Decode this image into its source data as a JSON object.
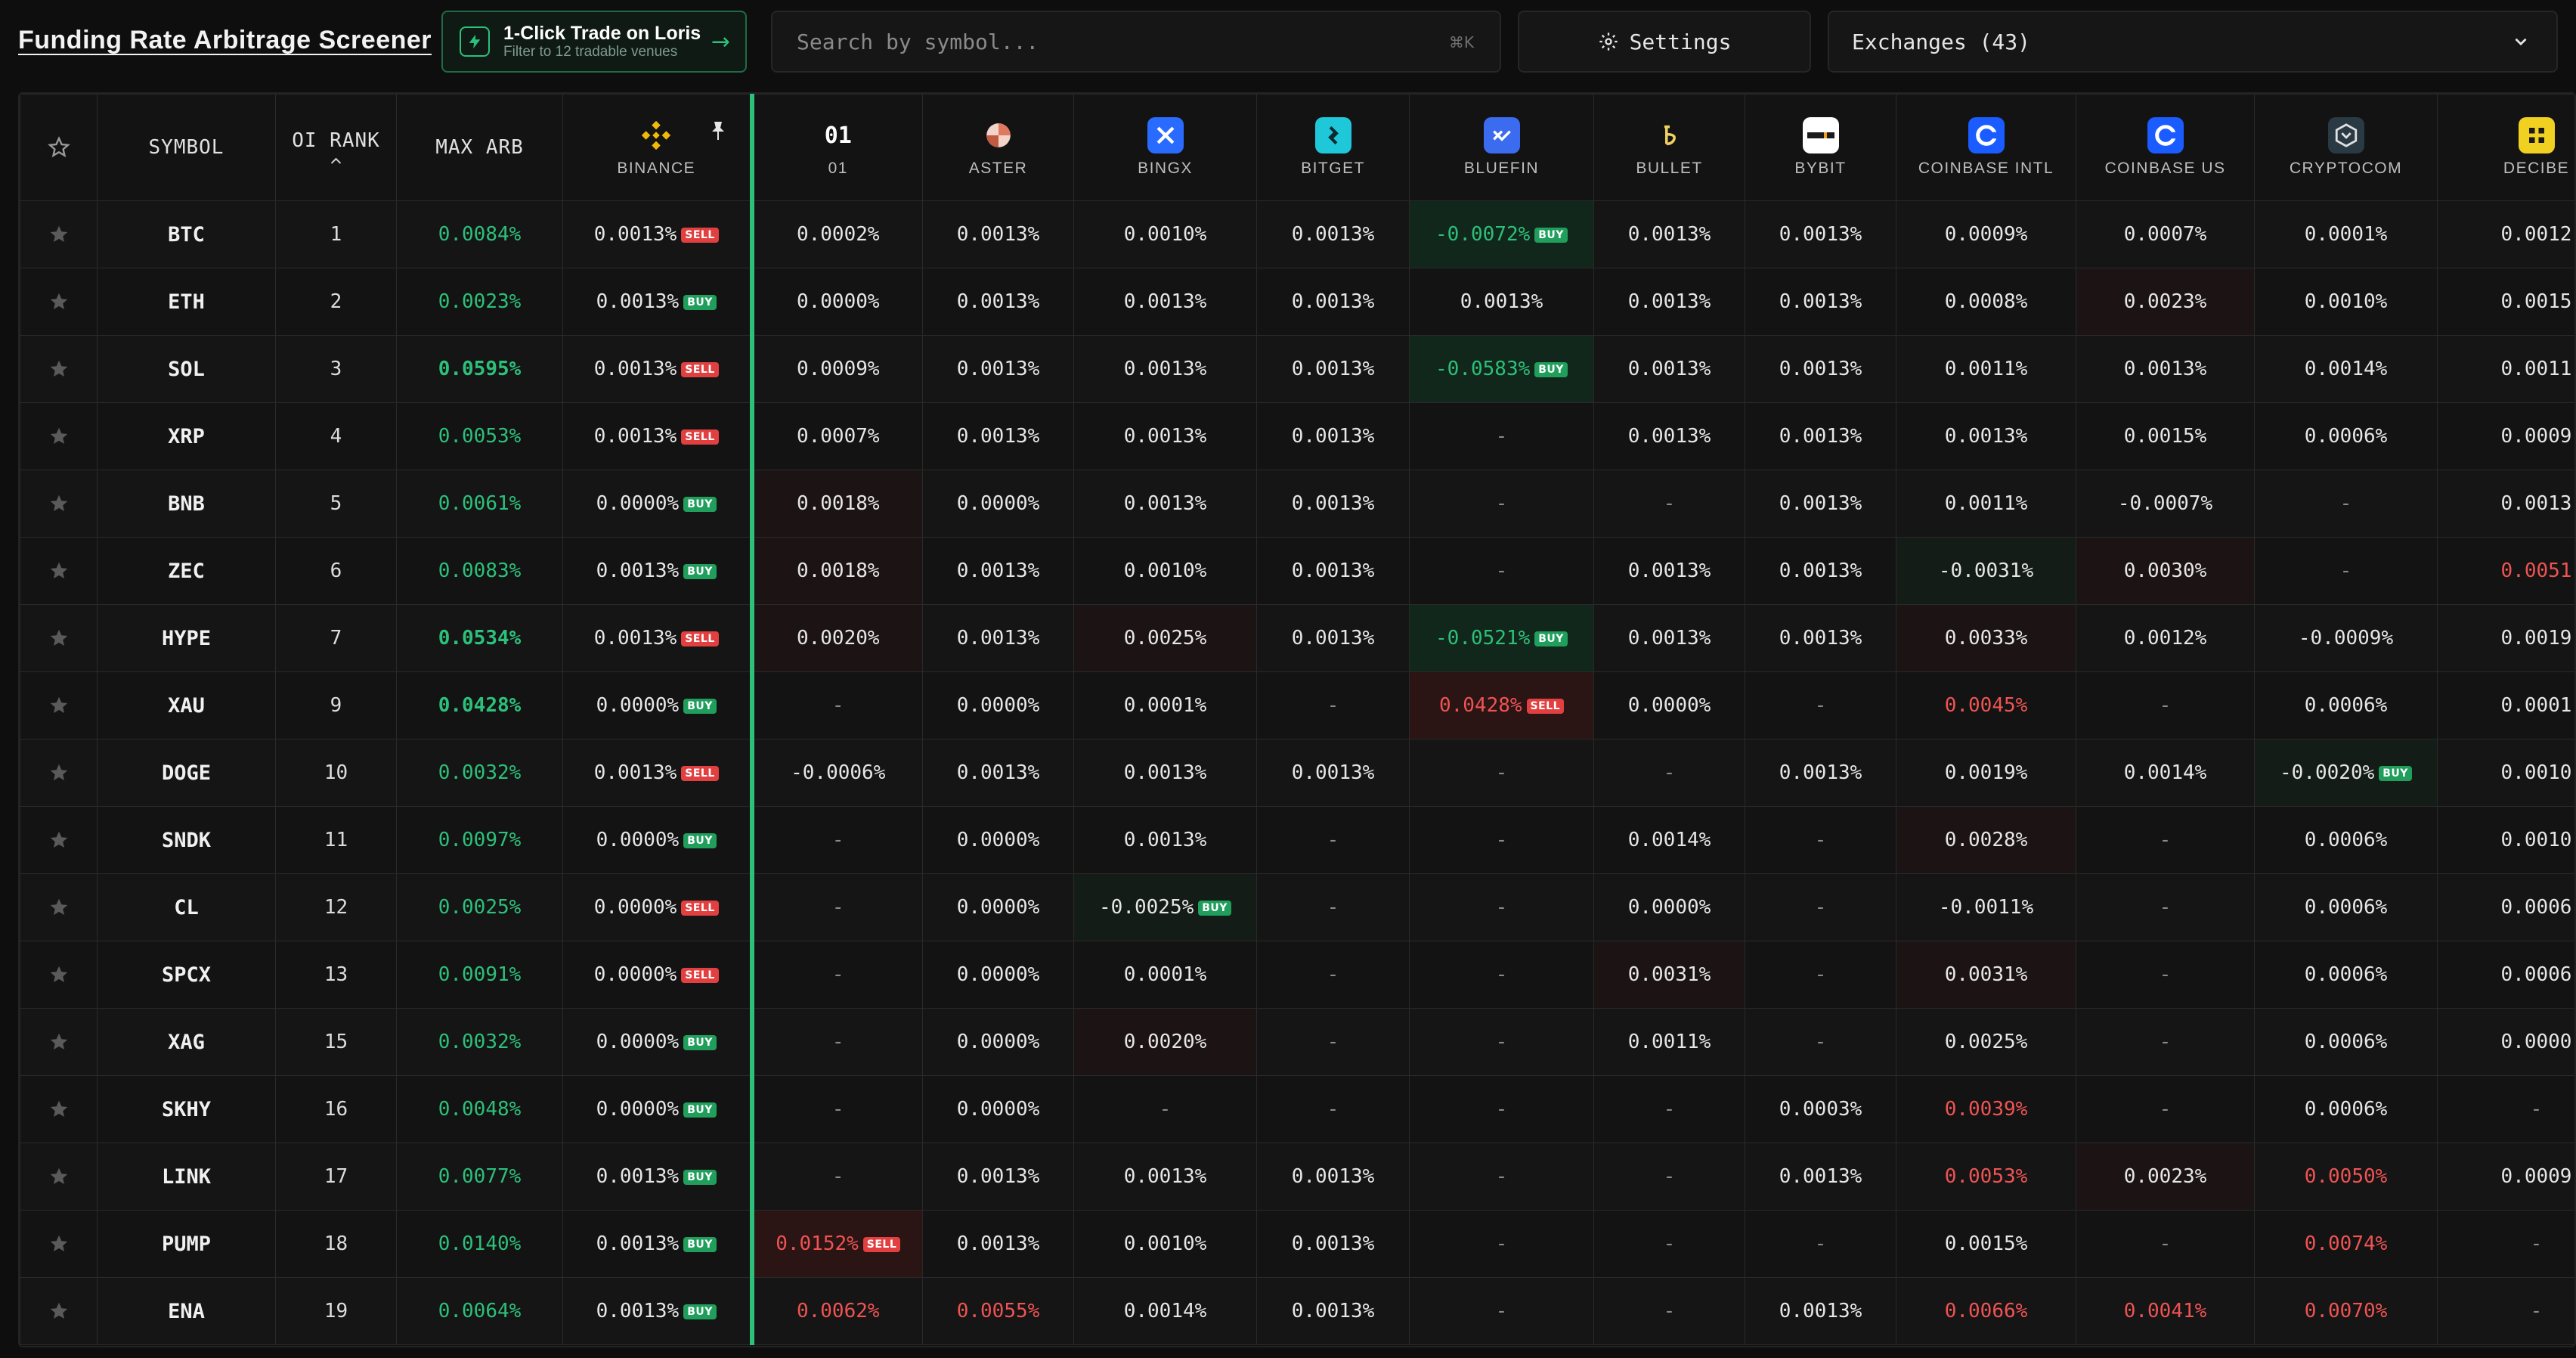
{
  "header": {
    "title": "Funding Rate Arbitrage Screener",
    "trade_button": {
      "label": "1-Click Trade on Loris",
      "sublabel": "Filter to 12 tradable venues",
      "arrow": "→"
    },
    "search": {
      "placeholder": "Search by symbol...",
      "shortcut": "⌘K"
    },
    "settings_label": "Settings",
    "exchanges_label": "Exchanges (43)"
  },
  "colors": {
    "accent_green": "#2cc07a",
    "sell_red": "#e24040",
    "buy_green": "#1f9e5c",
    "negative_red_text": "#ef5353"
  },
  "columns": {
    "symbol": "SYMBOL",
    "oi_rank": "OI RANK",
    "max_arb": "MAX ARB",
    "exchanges": [
      {
        "name": "BINANCE",
        "icon": "binance-icon",
        "color": "#f0b90b"
      },
      {
        "name": "01",
        "icon": "01-text-icon",
        "color": "#ffffff"
      },
      {
        "name": "ASTER",
        "icon": "aster-icon",
        "color": "#e8a090"
      },
      {
        "name": "BINGX",
        "icon": "bingx-icon",
        "color": "#2a6bff"
      },
      {
        "name": "BITGET",
        "icon": "bitget-icon",
        "color": "#1ec8d8"
      },
      {
        "name": "BLUEFIN",
        "icon": "bluefin-icon",
        "color": "#3b6cf0"
      },
      {
        "name": "BULLET",
        "icon": "bullet-icon",
        "color": "#f0d060"
      },
      {
        "name": "BYBIT",
        "icon": "bybit-icon",
        "color": "#ffffff"
      },
      {
        "name": "COINBASE INTL",
        "icon": "coinbase-icon",
        "color": "#1a5cff"
      },
      {
        "name": "COINBASE US",
        "icon": "coinbase-icon",
        "color": "#1a5cff"
      },
      {
        "name": "CRYPTOCOM",
        "icon": "cryptocom-icon",
        "color": "#2a3a44"
      },
      {
        "name": "DECIBE",
        "icon": "decibel-icon",
        "color": "#f0d020"
      }
    ]
  },
  "rows": [
    {
      "symbol": "BTC",
      "rank": "1",
      "arb": "0.0084%",
      "bold": false,
      "binance": {
        "v": "0.0013%",
        "b": "SELL"
      },
      "cells": [
        [
          "0.0002%"
        ],
        [
          "0.0013%"
        ],
        [
          "0.0010%"
        ],
        [
          "0.0013%"
        ],
        [
          "-0.0072%",
          "neg-green",
          "BUY"
        ],
        [
          "0.0013%"
        ],
        [
          "0.0013%"
        ],
        [
          "0.0009%"
        ],
        [
          "0.0007%"
        ],
        [
          "0.0001%"
        ],
        [
          "0.0012"
        ]
      ]
    },
    {
      "symbol": "ETH",
      "rank": "2",
      "arb": "0.0023%",
      "bold": false,
      "binance": {
        "v": "0.0013%",
        "b": "BUY"
      },
      "cells": [
        [
          "0.0000%"
        ],
        [
          "0.0013%"
        ],
        [
          "0.0013%"
        ],
        [
          "0.0013%"
        ],
        [
          "0.0013%"
        ],
        [
          "0.0013%"
        ],
        [
          "0.0013%"
        ],
        [
          "0.0008%"
        ],
        [
          "0.0023%",
          "tint-red"
        ],
        [
          "0.0010%"
        ],
        [
          "0.0015"
        ]
      ]
    },
    {
      "symbol": "SOL",
      "rank": "3",
      "arb": "0.0595%",
      "bold": true,
      "binance": {
        "v": "0.0013%",
        "b": "SELL"
      },
      "cells": [
        [
          "0.0009%"
        ],
        [
          "0.0013%"
        ],
        [
          "0.0013%"
        ],
        [
          "0.0013%"
        ],
        [
          "-0.0583%",
          "neg-green",
          "BUY"
        ],
        [
          "0.0013%"
        ],
        [
          "0.0013%"
        ],
        [
          "0.0011%"
        ],
        [
          "0.0013%"
        ],
        [
          "0.0014%"
        ],
        [
          "0.0011"
        ]
      ]
    },
    {
      "symbol": "XRP",
      "rank": "4",
      "arb": "0.0053%",
      "bold": false,
      "binance": {
        "v": "0.0013%",
        "b": "SELL"
      },
      "cells": [
        [
          "0.0007%"
        ],
        [
          "0.0013%"
        ],
        [
          "0.0013%"
        ],
        [
          "0.0013%"
        ],
        [
          "-",
          "dash"
        ],
        [
          "0.0013%"
        ],
        [
          "0.0013%"
        ],
        [
          "0.0013%"
        ],
        [
          "0.0015%"
        ],
        [
          "0.0006%"
        ],
        [
          "0.0009"
        ]
      ]
    },
    {
      "symbol": "BNB",
      "rank": "5",
      "arb": "0.0061%",
      "bold": false,
      "binance": {
        "v": "0.0000%",
        "b": "BUY"
      },
      "cells": [
        [
          "0.0018%",
          "tint-red"
        ],
        [
          "0.0000%"
        ],
        [
          "0.0013%"
        ],
        [
          "0.0013%"
        ],
        [
          "-",
          "dash"
        ],
        [
          "-",
          "dash"
        ],
        [
          "0.0013%"
        ],
        [
          "0.0011%"
        ],
        [
          "-0.0007%"
        ],
        [
          "-",
          "dash"
        ],
        [
          "0.0013"
        ]
      ]
    },
    {
      "symbol": "ZEC",
      "rank": "6",
      "arb": "0.0083%",
      "bold": false,
      "binance": {
        "v": "0.0013%",
        "b": "BUY"
      },
      "cells": [
        [
          "0.0018%",
          "tint-red"
        ],
        [
          "0.0013%"
        ],
        [
          "0.0010%"
        ],
        [
          "0.0013%"
        ],
        [
          "-",
          "dash"
        ],
        [
          "0.0013%"
        ],
        [
          "0.0013%"
        ],
        [
          "-0.0031%",
          "tint-green"
        ],
        [
          "0.0030%",
          "tint-red"
        ],
        [
          "-",
          "dash"
        ],
        [
          "0.0051",
          "red-txt"
        ]
      ]
    },
    {
      "symbol": "HYPE",
      "rank": "7",
      "arb": "0.0534%",
      "bold": true,
      "binance": {
        "v": "0.0013%",
        "b": "SELL"
      },
      "cells": [
        [
          "0.0020%",
          "tint-red"
        ],
        [
          "0.0013%"
        ],
        [
          "0.0025%",
          "tint-red"
        ],
        [
          "0.0013%"
        ],
        [
          "-0.0521%",
          "neg-green",
          "BUY"
        ],
        [
          "0.0013%"
        ],
        [
          "0.0013%"
        ],
        [
          "0.0033%",
          "tint-red"
        ],
        [
          "0.0012%"
        ],
        [
          "-0.0009%"
        ],
        [
          "0.0019"
        ]
      ]
    },
    {
      "symbol": "XAU",
      "rank": "9",
      "arb": "0.0428%",
      "bold": true,
      "binance": {
        "v": "0.0000%",
        "b": "BUY"
      },
      "cells": [
        [
          "-",
          "dash"
        ],
        [
          "0.0000%"
        ],
        [
          "0.0001%"
        ],
        [
          "-",
          "dash"
        ],
        [
          "0.0428%",
          "pos-red",
          "SELL"
        ],
        [
          "0.0000%"
        ],
        [
          "-",
          "dash"
        ],
        [
          "0.0045%",
          "red-txt"
        ],
        [
          "-",
          "dash"
        ],
        [
          "0.0006%"
        ],
        [
          "0.0001"
        ]
      ]
    },
    {
      "symbol": "DOGE",
      "rank": "10",
      "arb": "0.0032%",
      "bold": false,
      "binance": {
        "v": "0.0013%",
        "b": "SELL"
      },
      "cells": [
        [
          "-0.0006%"
        ],
        [
          "0.0013%"
        ],
        [
          "0.0013%"
        ],
        [
          "0.0013%"
        ],
        [
          "-",
          "dash"
        ],
        [
          "-",
          "dash"
        ],
        [
          "0.0013%"
        ],
        [
          "0.0019%"
        ],
        [
          "0.0014%"
        ],
        [
          "-0.0020%",
          "tint-green",
          "BUY"
        ],
        [
          "0.0010"
        ]
      ]
    },
    {
      "symbol": "SNDK",
      "rank": "11",
      "arb": "0.0097%",
      "bold": false,
      "binance": {
        "v": "0.0000%",
        "b": "BUY"
      },
      "cells": [
        [
          "-",
          "dash"
        ],
        [
          "0.0000%"
        ],
        [
          "0.0013%"
        ],
        [
          "-",
          "dash"
        ],
        [
          "-",
          "dash"
        ],
        [
          "0.0014%"
        ],
        [
          "-",
          "dash"
        ],
        [
          "0.0028%",
          "tint-red"
        ],
        [
          "-",
          "dash"
        ],
        [
          "0.0006%"
        ],
        [
          "0.0010"
        ]
      ]
    },
    {
      "symbol": "CL",
      "rank": "12",
      "arb": "0.0025%",
      "bold": false,
      "binance": {
        "v": "0.0000%",
        "b": "SELL"
      },
      "cells": [
        [
          "-",
          "dash"
        ],
        [
          "0.0000%"
        ],
        [
          "-0.0025%",
          "tint-green",
          "BUY"
        ],
        [
          "-",
          "dash"
        ],
        [
          "-",
          "dash"
        ],
        [
          "0.0000%"
        ],
        [
          "-",
          "dash"
        ],
        [
          "-0.0011%"
        ],
        [
          "-",
          "dash"
        ],
        [
          "0.0006%"
        ],
        [
          "0.0006"
        ]
      ]
    },
    {
      "symbol": "SPCX",
      "rank": "13",
      "arb": "0.0091%",
      "bold": false,
      "binance": {
        "v": "0.0000%",
        "b": "SELL"
      },
      "cells": [
        [
          "-",
          "dash"
        ],
        [
          "0.0000%"
        ],
        [
          "0.0001%"
        ],
        [
          "-",
          "dash"
        ],
        [
          "-",
          "dash"
        ],
        [
          "0.0031%",
          "tint-red"
        ],
        [
          "-",
          "dash"
        ],
        [
          "0.0031%",
          "tint-red"
        ],
        [
          "-",
          "dash"
        ],
        [
          "0.0006%"
        ],
        [
          "0.0006"
        ]
      ]
    },
    {
      "symbol": "XAG",
      "rank": "15",
      "arb": "0.0032%",
      "bold": false,
      "binance": {
        "v": "0.0000%",
        "b": "BUY"
      },
      "cells": [
        [
          "-",
          "dash"
        ],
        [
          "0.0000%"
        ],
        [
          "0.0020%",
          "tint-red"
        ],
        [
          "-",
          "dash"
        ],
        [
          "-",
          "dash"
        ],
        [
          "0.0011%"
        ],
        [
          "-",
          "dash"
        ],
        [
          "0.0025%"
        ],
        [
          "-",
          "dash"
        ],
        [
          "0.0006%"
        ],
        [
          "0.0000"
        ]
      ]
    },
    {
      "symbol": "SKHY",
      "rank": "16",
      "arb": "0.0048%",
      "bold": false,
      "binance": {
        "v": "0.0000%",
        "b": "BUY"
      },
      "cells": [
        [
          "-",
          "dash"
        ],
        [
          "0.0000%"
        ],
        [
          "-",
          "dash"
        ],
        [
          "-",
          "dash"
        ],
        [
          "-",
          "dash"
        ],
        [
          "-",
          "dash"
        ],
        [
          "0.0003%"
        ],
        [
          "0.0039%",
          "red-txt"
        ],
        [
          "-",
          "dash"
        ],
        [
          "0.0006%"
        ],
        [
          "-",
          "dash"
        ]
      ]
    },
    {
      "symbol": "LINK",
      "rank": "17",
      "arb": "0.0077%",
      "bold": false,
      "binance": {
        "v": "0.0013%",
        "b": "BUY"
      },
      "cells": [
        [
          "-",
          "dash"
        ],
        [
          "0.0013%"
        ],
        [
          "0.0013%"
        ],
        [
          "0.0013%"
        ],
        [
          "-",
          "dash"
        ],
        [
          "-",
          "dash"
        ],
        [
          "0.0013%"
        ],
        [
          "0.0053%",
          "red-txt"
        ],
        [
          "0.0023%",
          "tint-red"
        ],
        [
          "0.0050%",
          "red-txt"
        ],
        [
          "0.0009"
        ]
      ]
    },
    {
      "symbol": "PUMP",
      "rank": "18",
      "arb": "0.0140%",
      "bold": false,
      "binance": {
        "v": "0.0013%",
        "b": "BUY"
      },
      "cells": [
        [
          "0.0152%",
          "pos-red",
          "SELL"
        ],
        [
          "0.0013%"
        ],
        [
          "0.0010%"
        ],
        [
          "0.0013%"
        ],
        [
          "-",
          "dash"
        ],
        [
          "-",
          "dash"
        ],
        [
          "-",
          "dash"
        ],
        [
          "0.0015%"
        ],
        [
          "-",
          "dash"
        ],
        [
          "0.0074%",
          "red-txt"
        ],
        [
          "-",
          "dash"
        ]
      ]
    },
    {
      "symbol": "ENA",
      "rank": "19",
      "arb": "0.0064%",
      "bold": false,
      "binance": {
        "v": "0.0013%",
        "b": "BUY"
      },
      "cells": [
        [
          "0.0062%",
          "red-txt"
        ],
        [
          "0.0055%",
          "red-txt"
        ],
        [
          "0.0014%"
        ],
        [
          "0.0013%"
        ],
        [
          "-",
          "dash"
        ],
        [
          "-",
          "dash"
        ],
        [
          "0.0013%"
        ],
        [
          "0.0066%",
          "red-txt"
        ],
        [
          "0.0041%",
          "red-txt"
        ],
        [
          "0.0070%",
          "red-txt"
        ],
        [
          "-",
          "dash"
        ]
      ]
    }
  ]
}
